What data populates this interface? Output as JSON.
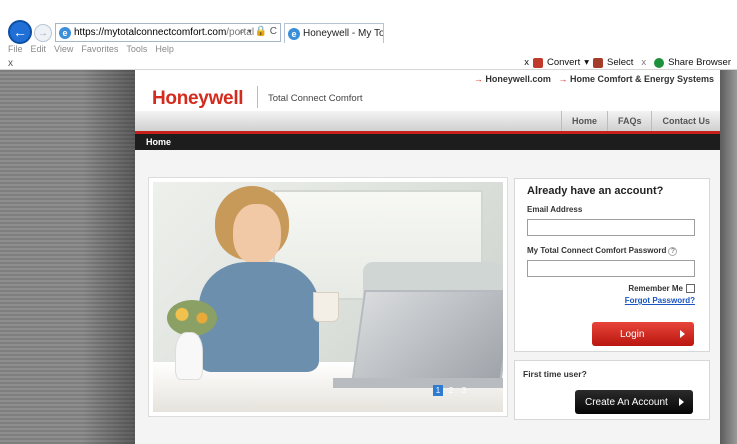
{
  "browser": {
    "url_main": "https://mytotalconnectcomfort.com",
    "url_path": "/portal",
    "address_tools": "⌕ ▾ 🔒 C",
    "tab_title": "Honeywell - My Total Conn...",
    "tab_close": "×",
    "menu": [
      "File",
      "Edit",
      "View",
      "Favorites",
      "Tools",
      "Help"
    ],
    "toolbar_close": "x",
    "toolbar_items": {
      "close1": "x",
      "convert": "Convert",
      "convert_caret": "▾",
      "select": "Select",
      "close2": "x",
      "share": "Share Browser"
    }
  },
  "site": {
    "util_links": {
      "link1": "Honeywell.com",
      "link2": "Home Comfort & Energy Systems"
    },
    "logo": "Honeywell",
    "tagline": "Total Connect Comfort",
    "nav": [
      "Home",
      "FAQs",
      "Contact Us"
    ],
    "breadcrumb": "Home",
    "carousel_pages": [
      "1",
      "2",
      "3"
    ],
    "login": {
      "title": "Already have an account?",
      "email_label": "Email Address",
      "password_label": "My Total Connect Comfort Password",
      "help": "?",
      "remember_label": "Remember Me",
      "forgot_label": "Forgot Password?",
      "button_label": "Login"
    },
    "signup": {
      "title": "First time user?",
      "button_label": "Create An Account"
    }
  },
  "colors": {
    "brand_red": "#d52b1e",
    "nav_black": "#1d1d1d",
    "link_blue": "#1a55c0"
  }
}
